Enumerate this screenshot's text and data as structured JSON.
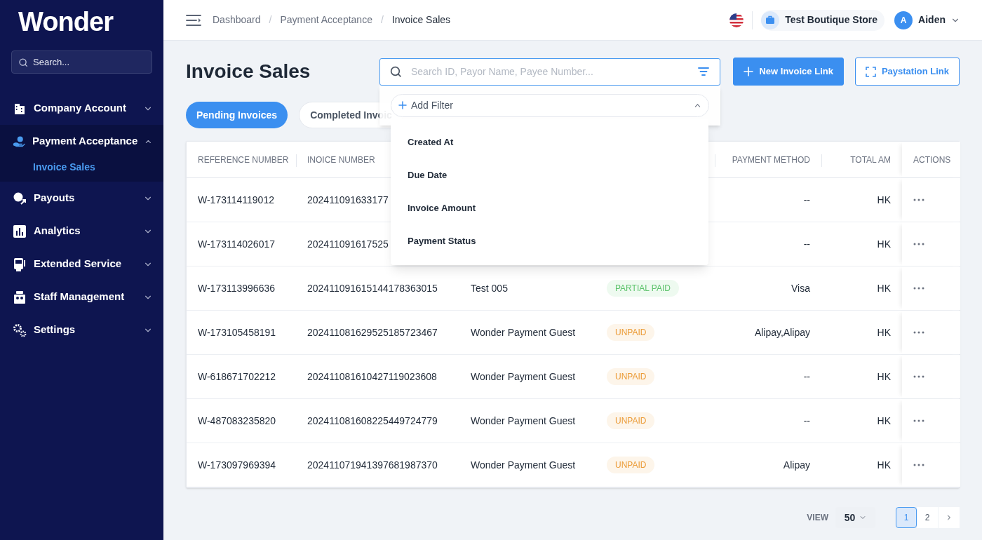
{
  "sidebar": {
    "logo": "Wonder",
    "search": {
      "placeholder": "Search..."
    },
    "items": [
      {
        "label": "Company Account",
        "expanded": false
      },
      {
        "label": "Payment Acceptance",
        "expanded": true,
        "children": [
          {
            "label": "Invoice Sales",
            "selected": true
          }
        ]
      },
      {
        "label": "Payouts",
        "expanded": false
      },
      {
        "label": "Analytics",
        "expanded": false
      },
      {
        "label": "Extended Service",
        "expanded": false
      },
      {
        "label": "Staff Management",
        "expanded": false
      },
      {
        "label": "Settings",
        "expanded": false
      }
    ]
  },
  "header": {
    "breadcrumbs": [
      "Dashboard",
      "Payment Acceptance",
      "Invoice Sales"
    ],
    "separator": "/",
    "store": "Test Boutique Store",
    "user": {
      "initial": "A",
      "name": "Aiden"
    }
  },
  "page": {
    "title": "Invoice Sales",
    "search": {
      "placeholder": "Search ID, Payor Name, Payee Number..."
    },
    "buttons": [
      {
        "label": "New Invoice Link",
        "kind": "primary"
      },
      {
        "label": "Paystation Link",
        "kind": "outline"
      }
    ],
    "tabs": [
      {
        "label": "Pending Invoices",
        "selected": true
      },
      {
        "label": "Completed Invoic",
        "selected": false
      }
    ]
  },
  "filter_dropdown": {
    "add_filter": "Add Filter",
    "expanded": true,
    "options": [
      "Created At",
      "Due Date",
      "Invoice Amount",
      "Payment Status"
    ]
  },
  "table": {
    "columns": [
      {
        "label": "REFERENCE NUMBER"
      },
      {
        "label": "INOICE NUMBER"
      },
      {},
      {},
      {
        "label": "PAYMENT METHOD"
      },
      {
        "label": "TOTAL AM"
      },
      {
        "label": "ACTIONS"
      }
    ],
    "rows": [
      {
        "reference": "W-173114119012",
        "invoice": "202411091633177",
        "method": "--",
        "total": "HK"
      },
      {
        "reference": "W-173114026017",
        "invoice": "202411091617525",
        "method": "--",
        "total": "HK"
      },
      {
        "reference": "W-173113996636",
        "invoice": "202411091615144178363015",
        "payer": "Test 005",
        "status": {
          "label": "PARTIAL PAID",
          "kind": "partial"
        },
        "method": "Visa",
        "total": "HK"
      },
      {
        "reference": "W-173105458191",
        "invoice": "202411081629525185723467",
        "payer": "Wonder Payment Guest",
        "status": {
          "label": "UNPAID",
          "kind": "unpaid"
        },
        "method": "Alipay,Alipay",
        "total": "HK"
      },
      {
        "reference": "W-618671702212",
        "invoice": "202411081610427119023608",
        "payer": "Wonder Payment Guest",
        "status": {
          "label": "UNPAID",
          "kind": "unpaid"
        },
        "method": "--",
        "total": "HK"
      },
      {
        "reference": "W-487083235820",
        "invoice": "202411081608225449724779",
        "payer": "Wonder Payment Guest",
        "status": {
          "label": "UNPAID",
          "kind": "unpaid"
        },
        "method": "--",
        "total": "HK"
      },
      {
        "reference": "W-173097969394",
        "invoice": "202411071941397681987370",
        "payer": "Wonder Payment Guest",
        "status": {
          "label": "UNPAID",
          "kind": "unpaid"
        },
        "method": "Alipay",
        "total": "HK"
      }
    ]
  },
  "pagination": {
    "view_label": "VIEW",
    "page_size": "50",
    "pages": [
      {
        "label": "1",
        "selected": true
      },
      {
        "label": "2",
        "selected": false
      }
    ]
  }
}
